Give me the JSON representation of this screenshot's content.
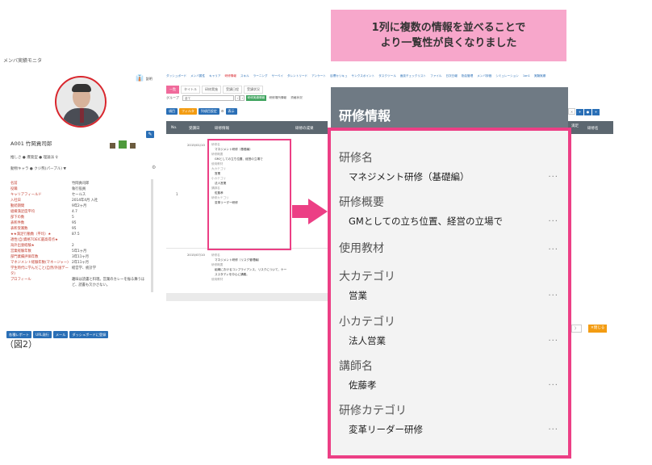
{
  "callout": {
    "line1": "1列に複数の情報を並べることで",
    "line2": "より一覧性が良くなりました"
  },
  "app": {
    "title": "メンバ実績モニタ"
  },
  "profile": {
    "id_name": "A001 竹岡貢司郎",
    "meta1": "推しさ ● 爆発型 ● 理論派 ♀",
    "meta2": "動物キャラ  ● クジ熊(パープル) ▼",
    "logo_text": "説明",
    "rows": [
      {
        "k": "名前",
        "v": "竹岡貢司郎"
      },
      {
        "k": "役職",
        "v": "執行役員"
      },
      {
        "k": "キャリアフィールド",
        "v": "セールス"
      },
      {
        "k": "入社日",
        "v": "2014年4月 入社"
      },
      {
        "k": "勤続期間",
        "v": "9年2ヶ月"
      },
      {
        "k": "組織満足度平均",
        "v": "4.7"
      },
      {
        "k": "部下の数",
        "v": "5"
      },
      {
        "k": "表彰件数",
        "v": "95"
      },
      {
        "k": "表彰受賞数",
        "v": "95"
      },
      {
        "k": "★★満足行動数（平均）★",
        "v": "87.5"
      },
      {
        "k": "適性(自)資格TOEIC最高得点★",
        "v": ""
      },
      {
        "k": "海外出張経験★",
        "v": "2"
      },
      {
        "k": "営業経験年数",
        "v": "5年1ヶ月"
      },
      {
        "k": "部門業績評価年数",
        "v": "3年11ヶ月"
      },
      {
        "k": "マネジメント経験年数(マネージャー)",
        "v": "2年11ヶ月"
      },
      {
        "k": "学生時代に学んだこと(自然/外国データ)",
        "v": "経営学、統計学"
      },
      {
        "k": "プロフィール",
        "v": "趣味は読書と料理。営業のカレーを振る舞うほど、読書も欠かさない。"
      }
    ]
  },
  "bottom_buttons": [
    "各種レポート",
    "URL発行",
    "メール",
    "ダッシュボードに登録"
  ],
  "figure_label": "（図2）",
  "nav": {
    "items": [
      "ダッシュボード",
      "メンバ属性",
      "キャリア",
      "研修情報",
      "スキル",
      "ラーニング",
      "サーベイ",
      "タレントリード",
      "アンケート",
      "目標カリキュ",
      "サンクスポイント",
      "タスクツール",
      "面談チェックリスト",
      "ファイル",
      "日次日報",
      "勤怠管理",
      "メンバ評価",
      "シミュレーション",
      "1on1",
      "実験実績"
    ],
    "active_index": 3
  },
  "subtabs": [
    "一覧",
    "タイトル",
    "研修実施",
    "受講日程",
    "受講状況"
  ],
  "group_row": {
    "label": "グループ",
    "value": "全て",
    "pill1": "研修実績情報",
    "pill2": "研修場所情報",
    "pill3": "資格状況"
  },
  "toolbar": [
    "項目",
    "フィルタ",
    "列項目設定",
    "⚙",
    "表示"
  ],
  "grid": {
    "col_no": "No.",
    "col_date": "受講日",
    "col_info": "研修情報",
    "col_result": "研修の成果",
    "col_r1": "満足",
    "col_r2": "研修名"
  },
  "rows_small": [
    {
      "num": "1",
      "date": "2015/01/10"
    },
    {
      "num": "",
      "date": "2015/07/10"
    }
  ],
  "small_detail": [
    {
      "t": "研修名",
      "v": "マネジメント研修（基礎編）"
    },
    {
      "t": "研修概要",
      "v": "GMとしての立ち位置、経営の立場で"
    },
    {
      "t": "使用教材",
      "v": ""
    },
    {
      "t": "大カテゴリ",
      "v": "営業"
    },
    {
      "t": "小カテゴリ",
      "v": "法人営業"
    },
    {
      "t": "講師名",
      "v": "佐藤孝"
    },
    {
      "t": "研修カテゴリ",
      "v": "変革リーダー研修"
    }
  ],
  "small_detail2": [
    {
      "t": "研修名",
      "v": "マネジメント研修（リスク管理編）"
    },
    {
      "t": "研修概要",
      "v": "組織におけるコンプライアンス、リスクについて、ケーススタディを中心に講義。"
    },
    {
      "t": "使用教材",
      "v": ""
    }
  ],
  "zoom": {
    "title": "研修情報",
    "fields": [
      {
        "label": "研修名",
        "value": "マネジメント研修（基礎編）"
      },
      {
        "label": "研修概要",
        "value": "GMとしての立ち位置、経営の立場で"
      },
      {
        "label": "使用教材",
        "value": ""
      },
      {
        "label": "大カテゴリ",
        "value": "営業"
      },
      {
        "label": "小カテゴリ",
        "value": "法人営業"
      },
      {
        "label": "講師名",
        "value": "佐藤孝"
      },
      {
        "label": "研修カテゴリ",
        "value": "変革リーダー研修"
      }
    ],
    "more": "..."
  },
  "close_button": "✕閉じる",
  "pager": "〉",
  "colors": {
    "accent": "#ec3f85",
    "brand": "#2a6fb6",
    "header": "#6f7a84"
  }
}
